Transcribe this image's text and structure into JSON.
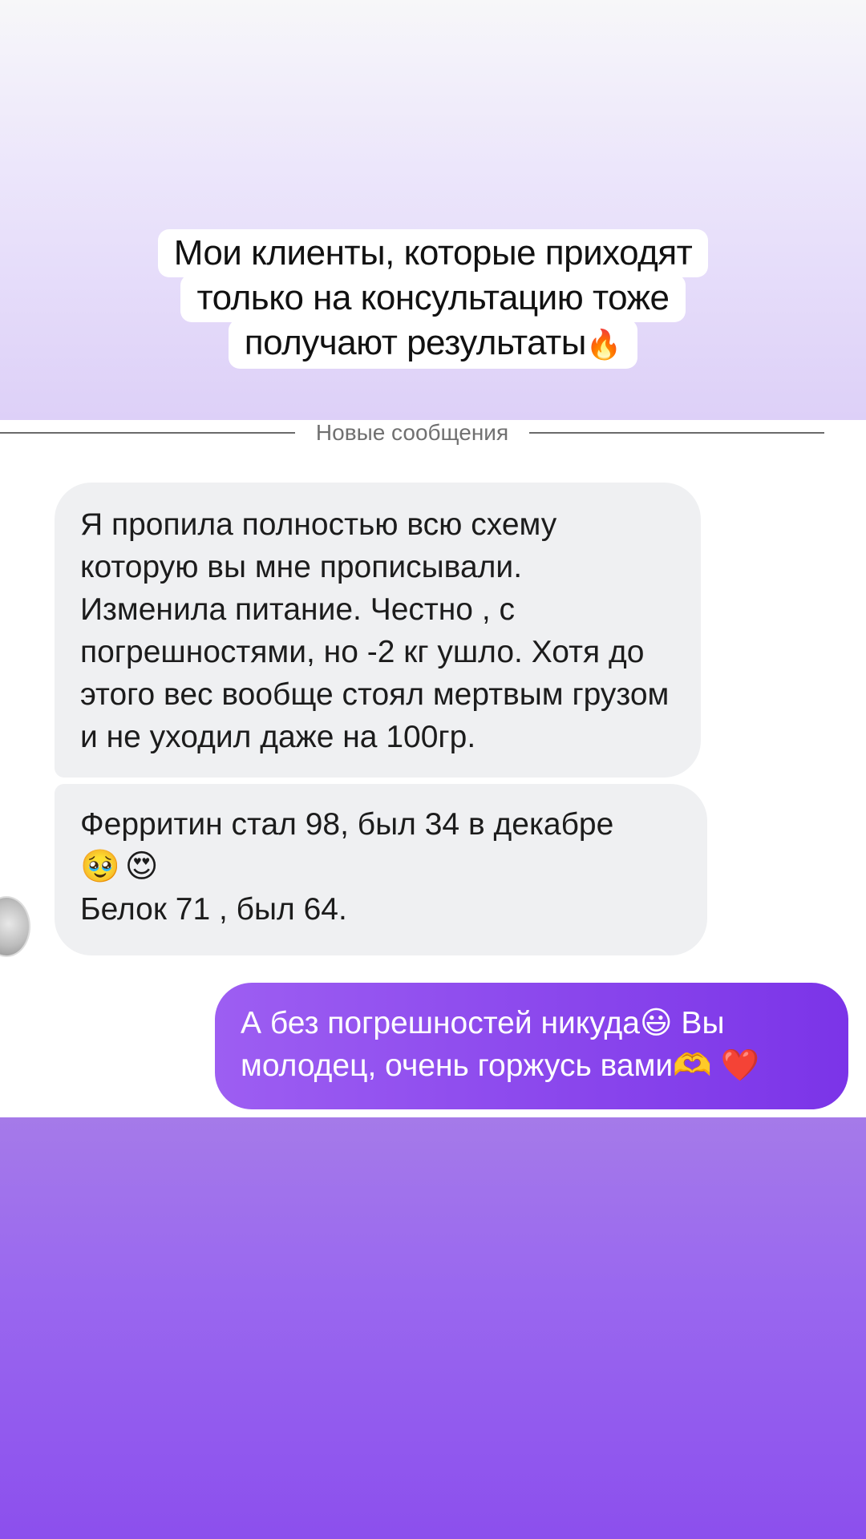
{
  "caption": {
    "lines": [
      "Мои клиенты, которые приходят",
      "только на консультацию тоже",
      "получают результаты"
    ],
    "emoji": "🔥"
  },
  "divider": {
    "label": "Новые сообщения"
  },
  "messages": [
    {
      "text": "Я пропила полностью всю схему которую вы мне прописывали. Изменила питание. Честно , с погрешностями, но -2 кг ушло. Хотя до этого вес вообще стоял мертвым грузом и не уходил даже на 100гр."
    },
    {
      "line1": "Ферритин стал 98, был 34 в декабре",
      "emojis": "🥹😍",
      "line2": "Белок 71 , был 64."
    },
    {
      "text": "А без погрешностей никуда😃 Вы молодец, очень горжусь вами🫶 ❤️"
    }
  ],
  "colors": {
    "incoming_bubble": "#eff0f2",
    "outgoing_bubble": "#8a45ee"
  }
}
